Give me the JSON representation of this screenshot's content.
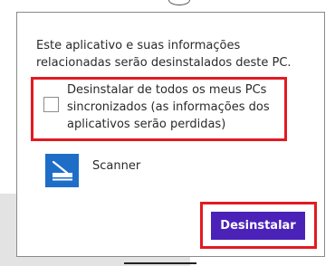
{
  "dialog": {
    "message_lines": [
      "Este aplicativo e suas informações",
      "relacionadas serão desinstalados deste PC."
    ],
    "option": {
      "checked": false,
      "label_lines": [
        "Desinstalar de todos os meus PCs",
        "sincronizados (as informações dos",
        "aplicativos serão perdidas)"
      ]
    },
    "app": {
      "name": "Scanner",
      "icon": "scanner-icon"
    },
    "uninstall_button_label": "Desinstalar"
  },
  "colors": {
    "highlight": "#e21a22",
    "button": "#4a22b8",
    "app_tile": "#1e6ec8"
  }
}
